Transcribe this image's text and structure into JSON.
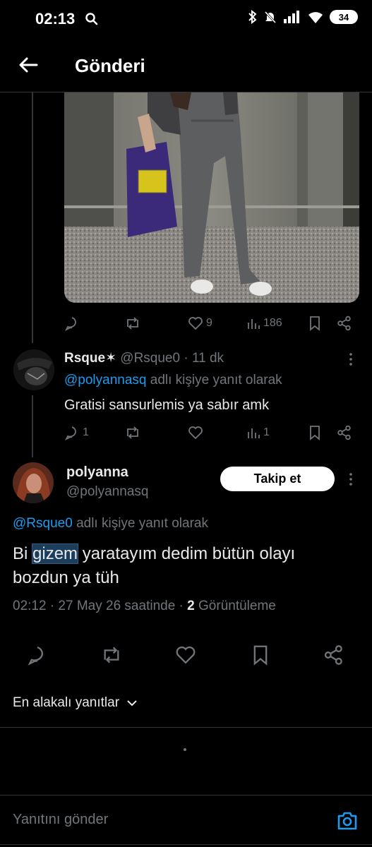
{
  "status_bar": {
    "time": "02:13",
    "battery": "34"
  },
  "header": {
    "title": "Gönderi"
  },
  "photo_post": {
    "stats": {
      "likes": "9",
      "views": "186"
    }
  },
  "reply1": {
    "name": "Rsque✶",
    "handle": "@Rsque0",
    "time": "· 11 dk",
    "reply_to_handle": "@polyannasq",
    "reply_to_suffix": "adlı kişiye yanıt olarak",
    "text": "Gratisi sansurlemis ya sabır amk",
    "stats": {
      "replies": "1",
      "views": "1"
    }
  },
  "main_post": {
    "name": "polyanna",
    "handle": "@polyannasq",
    "follow_label": "Takip et",
    "reply_to_handle": "@Rsque0",
    "reply_to_suffix": "adlı kişiye yanıt olarak",
    "text_before": "Bi ",
    "text_highlight": "gizem",
    "text_after": " yaratayım dedim bütün olayı bozdun ya tüh",
    "meta_time": "02:12 · 27 May 26 saatinde ·",
    "meta_views_count": "2",
    "meta_views_label": "Görüntüleme"
  },
  "sort": {
    "label": "En alakalı yanıtlar"
  },
  "composer": {
    "placeholder": "Yanıtını gönder"
  },
  "colors": {
    "accent": "#1d9bf0",
    "background": "#000000",
    "muted": "#71767b"
  }
}
